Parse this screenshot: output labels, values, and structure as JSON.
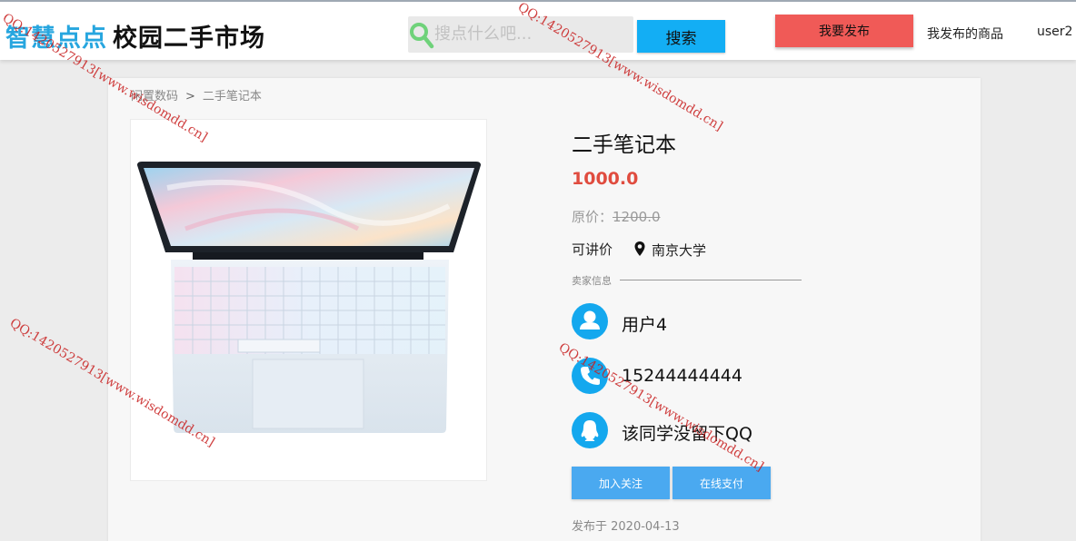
{
  "header": {
    "brand_colored": "智慧点点",
    "brand_dark": "校园二手市场",
    "search_placeholder": "搜点什么吧...",
    "search_button": "搜索",
    "publish_button": "我要发布",
    "my_goods": "我发布的商品",
    "username": "user2"
  },
  "breadcrumb": {
    "category": "闲置数码",
    "separator": ">",
    "current": "二手笔记本"
  },
  "product": {
    "image_icon": "laptop-photo",
    "title": "二手笔记本",
    "price": "1000.0",
    "original_label": "原价：",
    "original_price": "1200.0",
    "negotiable": "可讲价",
    "location": "南京大学",
    "posted": "发布于 2020-04-13"
  },
  "seller": {
    "section_label": "卖家信息",
    "name": "用户4",
    "phone": "15244444444",
    "qq": "该同学没留下QQ"
  },
  "actions": {
    "follow": "加入关注",
    "pay": "在线支付"
  },
  "watermark": {
    "text": "QQ:1420527913[www.wisdomdd.cn]"
  },
  "colors": {
    "brand_blue": "#27a6df",
    "search_button": "#13aef4",
    "publish_button": "#f05a57",
    "price_red": "#e04c3f",
    "icon_blue": "#14a8ee",
    "action_blue": "#4aa9f0"
  }
}
